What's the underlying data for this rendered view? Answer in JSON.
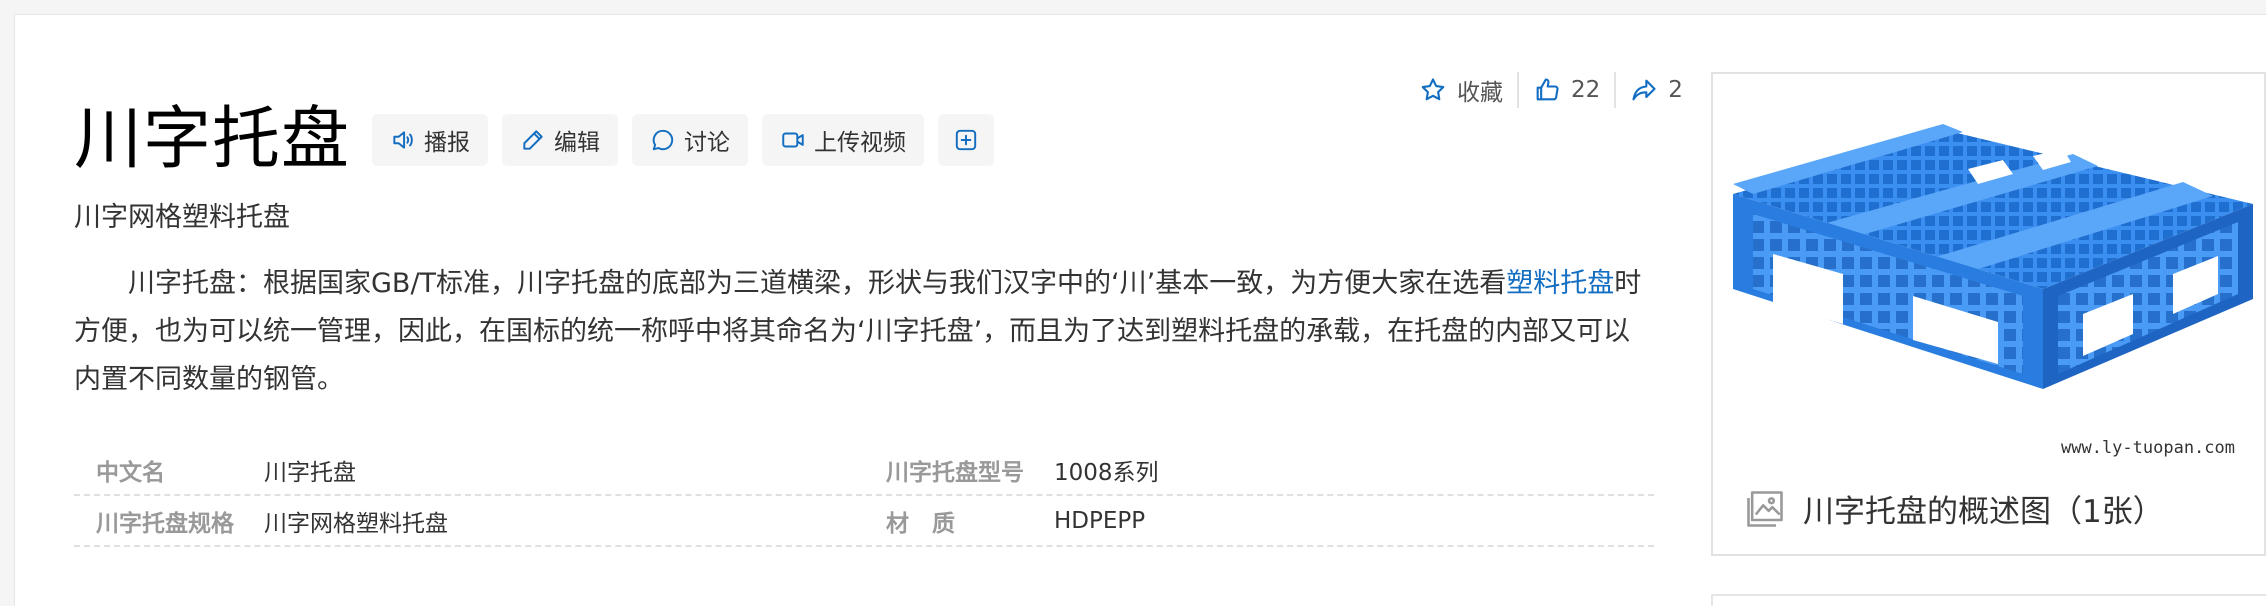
{
  "title": "川字托盘",
  "subtitle": "川字网格塑料托盘",
  "toolbar": {
    "broadcast": "播报",
    "edit": "编辑",
    "discuss": "讨论",
    "upload_video": "上传视频"
  },
  "actions": {
    "favorite": "收藏",
    "likes": "22",
    "shares": "2"
  },
  "summary": {
    "part1": "川字托盘：根据国家GB/T标准，川字托盘的底部为三道横梁，形状与我们汉字中的‘川’基本一致，为方便大家在选看",
    "link": "塑料托盘",
    "part2": "时方便，也为可以统一管理，因此，在国标的统一称呼中将其命名为‘川字托盘’，而且为了达到塑料托盘的承载，在托盘的内部又可以内置不同数量的钢管。"
  },
  "info": [
    {
      "name1": "中文名",
      "value1": "川字托盘",
      "name2": "川字托盘型号",
      "value2": "1008系列"
    },
    {
      "name1": "川字托盘规格",
      "value1": "川字网格塑料托盘",
      "name2": "材　质",
      "value2": "HDPEPP"
    }
  ],
  "album": {
    "watermark": "www.ly-tuopan.com",
    "caption": "川字托盘的概述图（1张）"
  },
  "colors": {
    "link": "#136ec2",
    "icon_blue": "#136ec2",
    "pallet_blue": "#2f86e8"
  },
  "icons": [
    "star-icon",
    "thumbs-up-icon",
    "share-icon",
    "speaker-icon",
    "pencil-icon",
    "chat-bubble-icon",
    "video-camera-icon",
    "plus-box-icon",
    "image-gallery-icon"
  ]
}
